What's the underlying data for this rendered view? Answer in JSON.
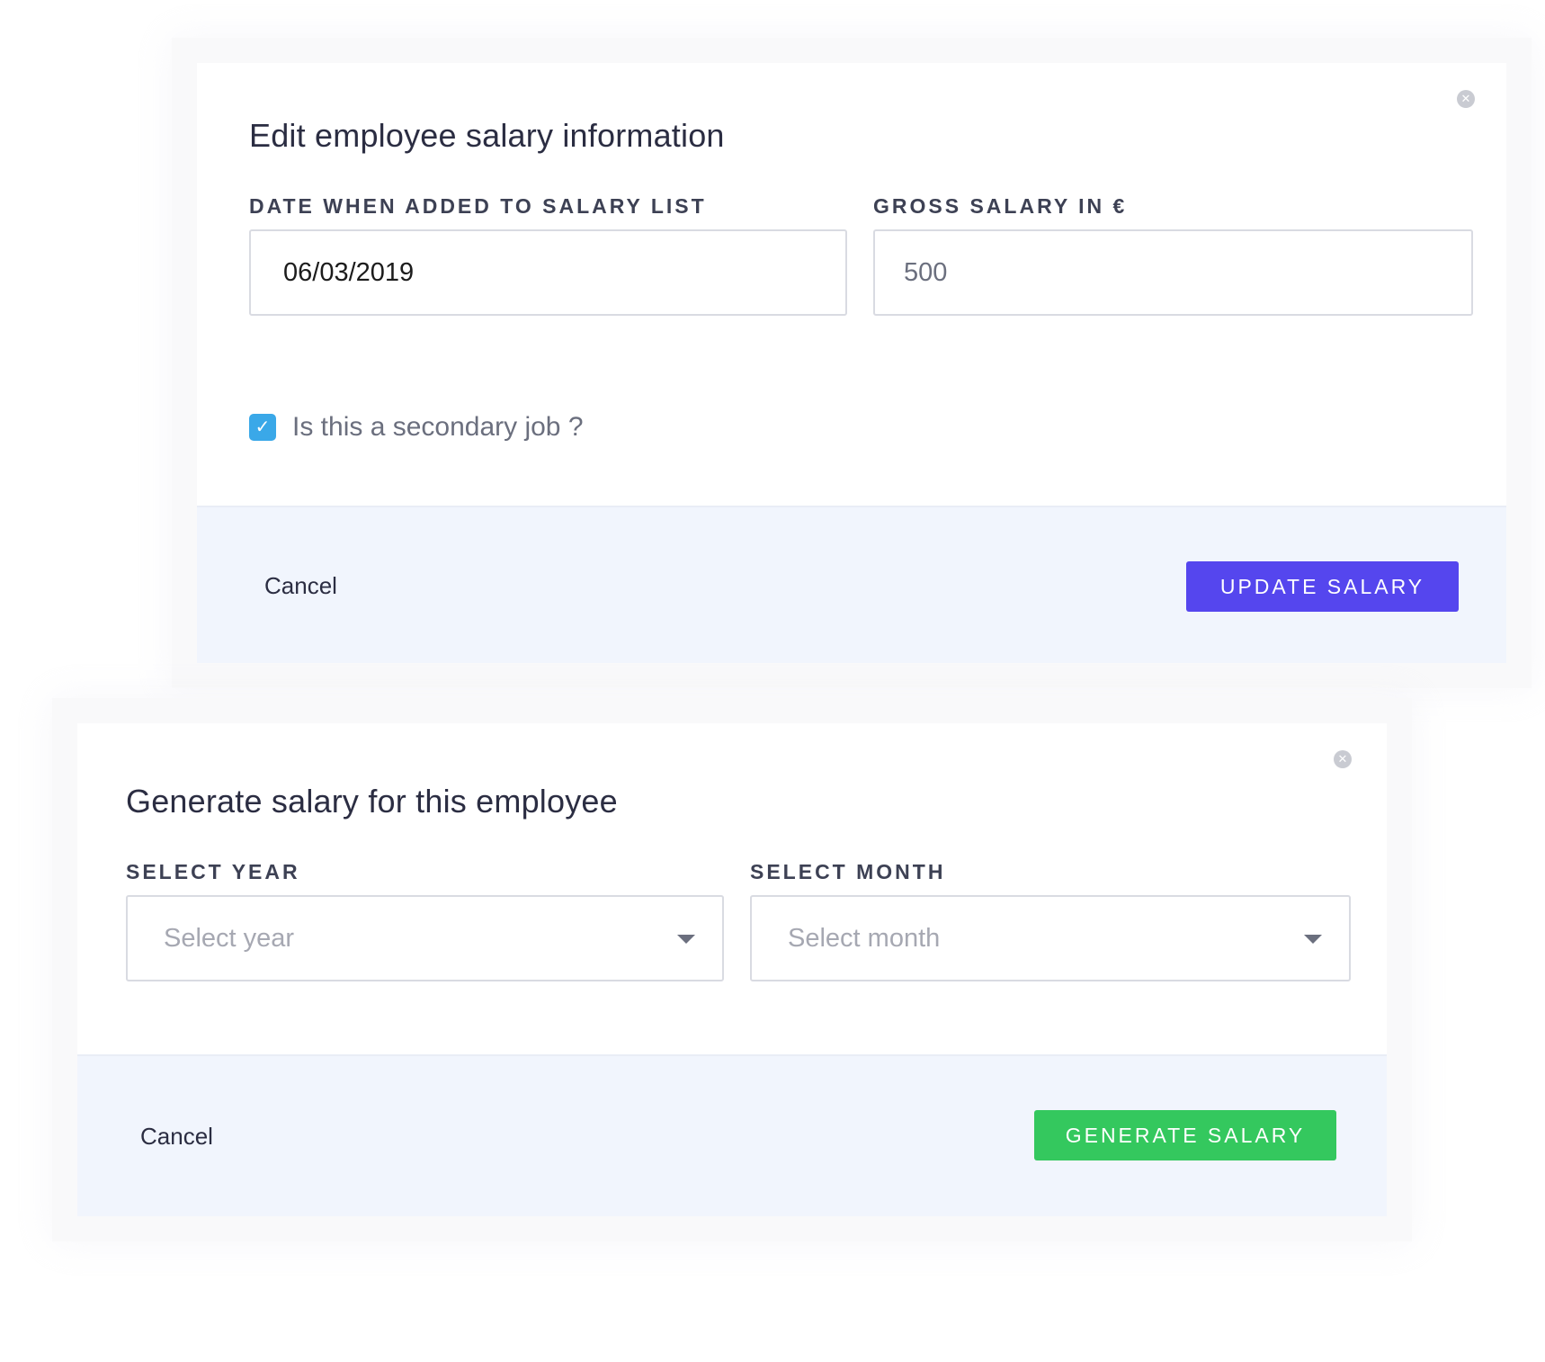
{
  "edit_modal": {
    "title": "Edit employee salary information",
    "close_icon": "close-icon",
    "date_label": "DATE WHEN ADDED TO SALARY LIST",
    "date_value": "06/03/2019",
    "gross_label": "GROSS SALARY IN €",
    "gross_value": "500",
    "secondary_job_label": "Is this a secondary job ?",
    "secondary_job_checked": true,
    "cancel_label": "Cancel",
    "submit_label": "UPDATE SALARY",
    "submit_color": "#5546ee"
  },
  "generate_modal": {
    "title": "Generate salary for this employee",
    "close_icon": "close-icon",
    "year_label": "SELECT YEAR",
    "year_placeholder": "Select year",
    "month_label": "SELECT MONTH",
    "month_placeholder": "Select month",
    "cancel_label": "Cancel",
    "submit_label": "GENERATE SALARY",
    "submit_color": "#34c85e"
  },
  "colors": {
    "footer_bg": "#f1f5fd",
    "checkbox": "#3aa8e8"
  }
}
